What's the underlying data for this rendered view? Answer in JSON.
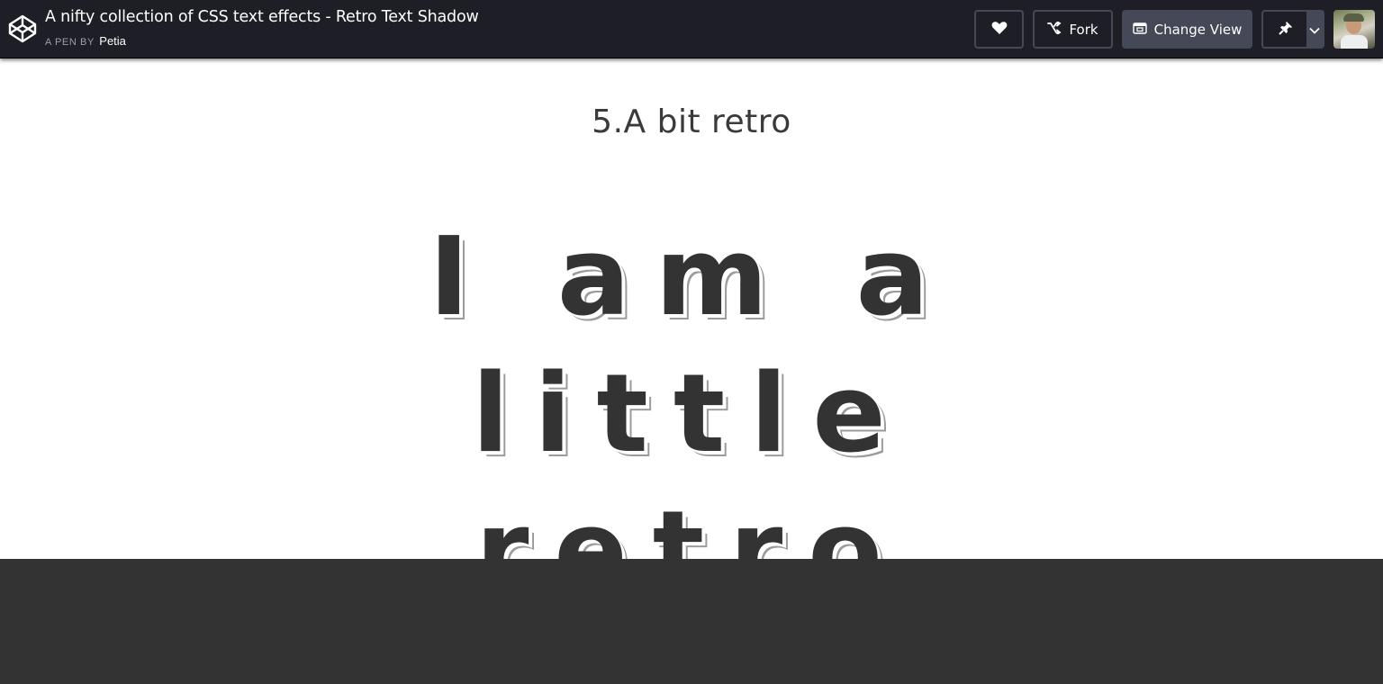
{
  "header": {
    "title": "A nifty collection of CSS text effects - Retro Text Shadow",
    "by_label": "A PEN BY",
    "author": "Petia",
    "fork_label": "Fork",
    "change_view_label": "Change View",
    "icons": [
      "codepen-logo-icon",
      "heart-icon",
      "fork-icon",
      "change-view-icon",
      "pin-icon",
      "chevron-down-icon"
    ]
  },
  "preview": {
    "heading": "5.A bit retro",
    "retro_text": "I am a little retro"
  },
  "colors": {
    "topbar_bg": "#1e1f26",
    "button_bg": "#444857",
    "text_dark": "#333333",
    "footer_bg": "#333333"
  }
}
